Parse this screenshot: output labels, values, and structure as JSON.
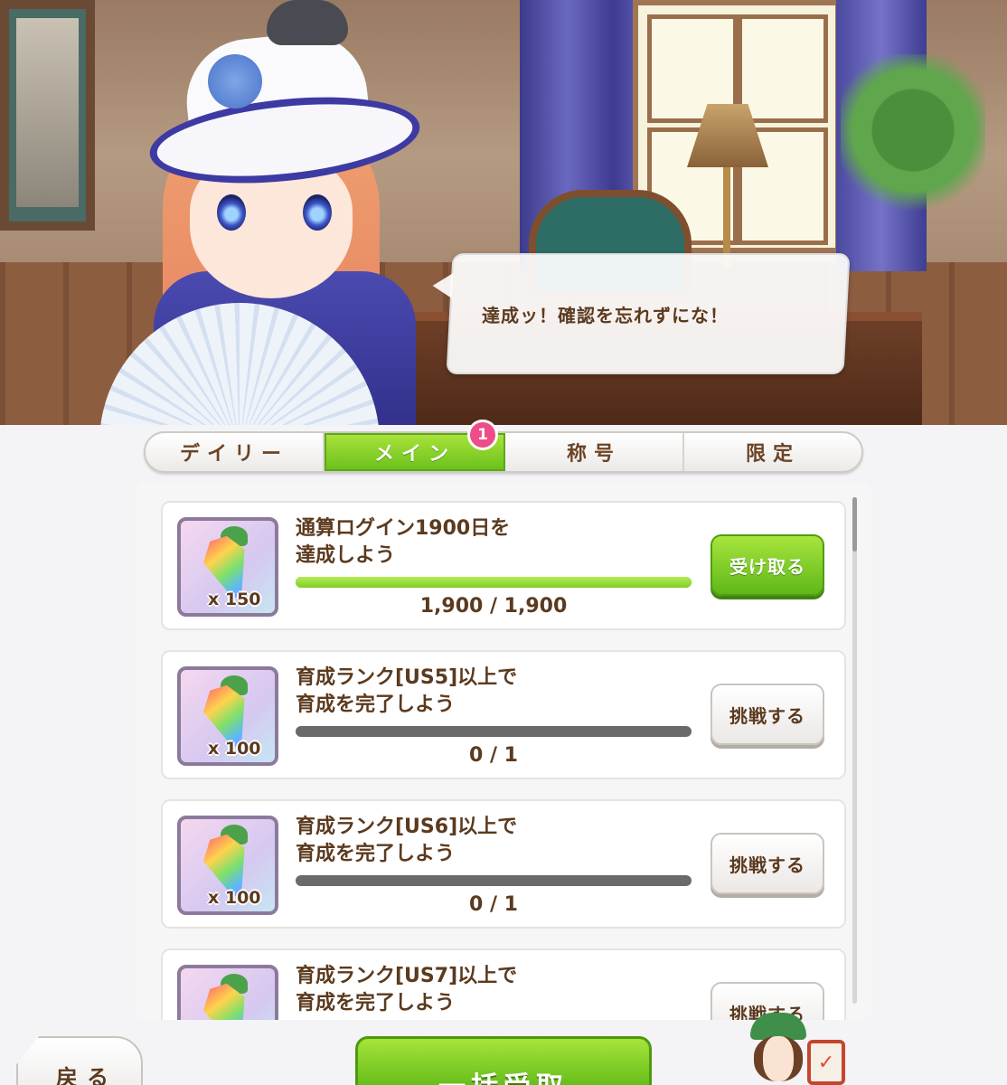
{
  "speech": {
    "text": "達成ッ！確認を忘れずにな！"
  },
  "tabs": [
    {
      "label": "デイリー",
      "active": false
    },
    {
      "label": "メイン",
      "active": true,
      "badge": "1"
    },
    {
      "label": "称号",
      "active": false
    },
    {
      "label": "限定",
      "active": false
    }
  ],
  "missions": [
    {
      "title": "通算ログイン1900日を\n達成しよう",
      "reward_qty": "x 150",
      "reward_icon": "carrot-gem-icon",
      "progress_text": "1,900 / 1,900",
      "progress_ratio": 1.0,
      "button_label": "受け取る",
      "button_kind": "receive"
    },
    {
      "title": "育成ランク[US5]以上で\n育成を完了しよう",
      "reward_qty": "x 100",
      "reward_icon": "carrot-gem-icon",
      "progress_text": "0 / 1",
      "progress_ratio": 0.0,
      "button_label": "挑戦する",
      "button_kind": "challenge"
    },
    {
      "title": "育成ランク[US6]以上で\n育成を完了しよう",
      "reward_qty": "x 100",
      "reward_icon": "carrot-gem-icon",
      "progress_text": "0 / 1",
      "progress_ratio": 0.0,
      "button_label": "挑戦する",
      "button_kind": "challenge"
    },
    {
      "title": "育成ランク[US7]以上で\n育成を完了しよう",
      "reward_qty": "",
      "reward_icon": "carrot-gem-icon",
      "progress_text": "",
      "progress_ratio": 0.0,
      "button_label": "挑戦する",
      "button_kind": "challenge"
    }
  ],
  "footer": {
    "back_label": "戻る",
    "bulk_receive_label": "一括受取",
    "clipboard_icon": "clipboard-check-icon"
  },
  "colors": {
    "accent_green": "#6cc21c",
    "text_brown": "#5b3a1e",
    "badge_pink": "#ee4d87"
  }
}
